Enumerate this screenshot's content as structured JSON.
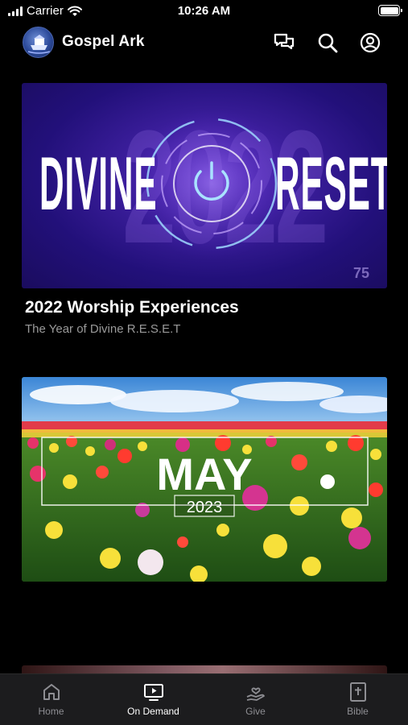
{
  "status_bar": {
    "carrier": "Carrier",
    "time": "10:26 AM"
  },
  "header": {
    "app_title": "Gospel Ark",
    "icons": [
      "chat-icon",
      "search-icon",
      "profile-icon"
    ]
  },
  "cards": [
    {
      "title": "2022 Worship Experiences",
      "subtitle": "The Year of Divine R.E.S.E.T",
      "image": {
        "word_left": "DIVINE",
        "word_right": "RESET",
        "background_year": "2022",
        "badge": "75"
      }
    },
    {
      "image": {
        "month": "MAY",
        "year": "2023"
      }
    }
  ],
  "tab_bar": {
    "tabs": [
      {
        "label": "Home",
        "icon": "home-icon",
        "active": false
      },
      {
        "label": "On Demand",
        "icon": "tv-play-icon",
        "active": true
      },
      {
        "label": "Give",
        "icon": "give-hand-heart-icon",
        "active": false
      },
      {
        "label": "Bible",
        "icon": "bible-icon",
        "active": false
      }
    ]
  },
  "colors": {
    "background": "#000000",
    "tab_bar": "#1c1c1e",
    "tab_inactive": "#8e8e93",
    "tab_active": "#ffffff",
    "subtitle": "#9a9a9a"
  }
}
